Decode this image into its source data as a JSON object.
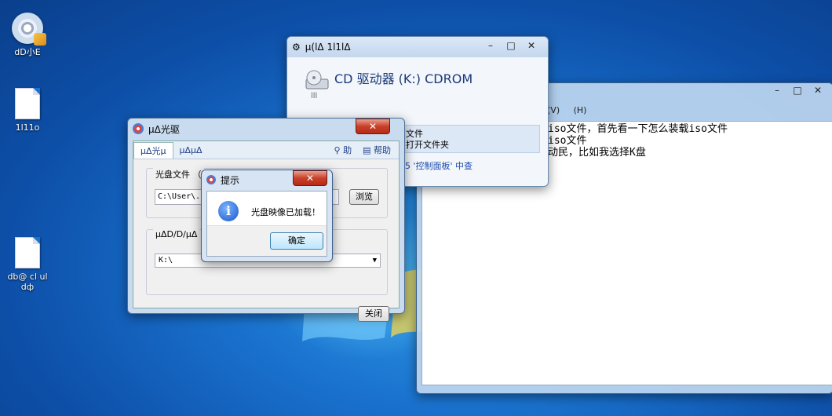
{
  "desktop": {
    "icons": [
      {
        "label": "dD小E",
        "type": "disc"
      },
      {
        "label": "1l11o",
        "type": "file"
      },
      {
        "label": "db@ cl ul dф",
        "type": "doc"
      }
    ]
  },
  "notepad": {
    "menu": [
      "(V)",
      "(H)"
    ],
    "lines": [
      "iso文件，首先看一下怎么装载iso文件",
      "iso文件",
      "动民，比如我选择K盘"
    ]
  },
  "cdrom": {
    "title": "µ(lΔ 1l1lΔ",
    "drive_label": "CD 驱动器 (K:) CDROM",
    "subtitle": "lll",
    "option_text_1": "文件",
    "option_text_2": "打开文件夹",
    "link": "5 '控制面板' 中查"
  },
  "burner": {
    "title": "µΔ光驱",
    "tabs": [
      "µΔ光µ",
      "µΔµΔ"
    ],
    "tab_right": [
      "助",
      "帮助"
    ],
    "group1_label": "光盘文件 （",
    "path_value": "C:\\User\\...\\D",
    "browse_label": "浏览",
    "group2_label": "µΔD/D/µΔ",
    "drive_select": "K:\\",
    "close_label": "关闭"
  },
  "messagebox": {
    "title": "提示",
    "message": "光盘映像已加载！",
    "ok_label": "确定",
    "icon": "info-icon"
  }
}
